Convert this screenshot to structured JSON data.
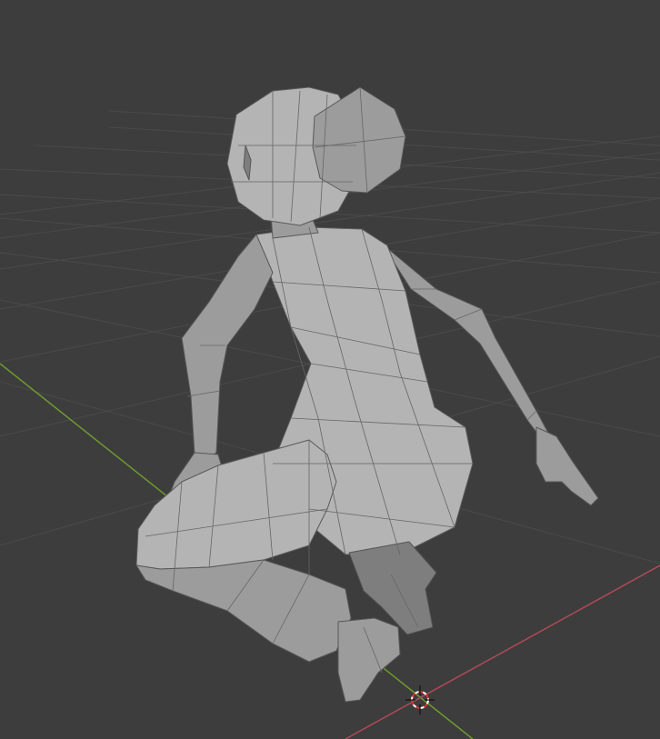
{
  "viewport": {
    "background": "#3d3d3d",
    "grid_color": "#4a4a4a",
    "x_axis_color": "#b04a58",
    "y_axis_color": "#6e9a2e",
    "mesh_color": "#a8a8a8",
    "wire_color": "#5c5c5c"
  },
  "scene": {
    "object": "low-poly-kneeling-character-mesh",
    "cursor": "3d-cursor-icon",
    "shading": "solid-with-wireframe-overlay"
  }
}
